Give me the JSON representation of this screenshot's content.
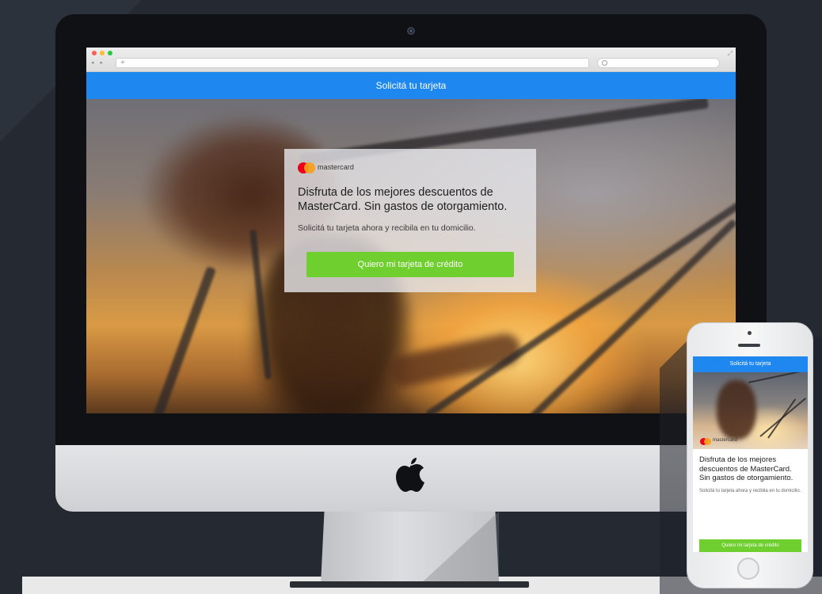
{
  "browser": {
    "nav_arrows": "◂ ▸",
    "new_tab_symbol": "+",
    "expand_symbol": "⤢"
  },
  "desktop": {
    "header_title": "Solicitá tu tarjeta",
    "brand": "mastercard",
    "headline": "Disfruta de los mejores descuentos de MasterCard. Sin gastos de otorgamiento.",
    "subtitle": "Solicitá tu tarjeta ahora y recibila en tu domicilio.",
    "cta_label": "Quiero mi tarjeta de crédito"
  },
  "mobile": {
    "header_title": "Solicitá tu tarjeta",
    "brand": "mastercard",
    "headline": "Disfruta de los mejores descuentos de MasterCard. Sin gastos de otorgamiento.",
    "subtitle": "Solicitá tu tarjeta ahora y recibila en tu domicilio.",
    "cta_label": "Quiero mi tarjeta de crédito"
  },
  "colors": {
    "header_blue": "#1e87f0",
    "cta_green": "#6fcf2f",
    "mastercard_red": "#eb001b",
    "mastercard_orange": "#f79e1b"
  },
  "icons": {
    "device_logo": "apple-logo-icon",
    "search": "search-icon",
    "expand": "expand-icon"
  }
}
